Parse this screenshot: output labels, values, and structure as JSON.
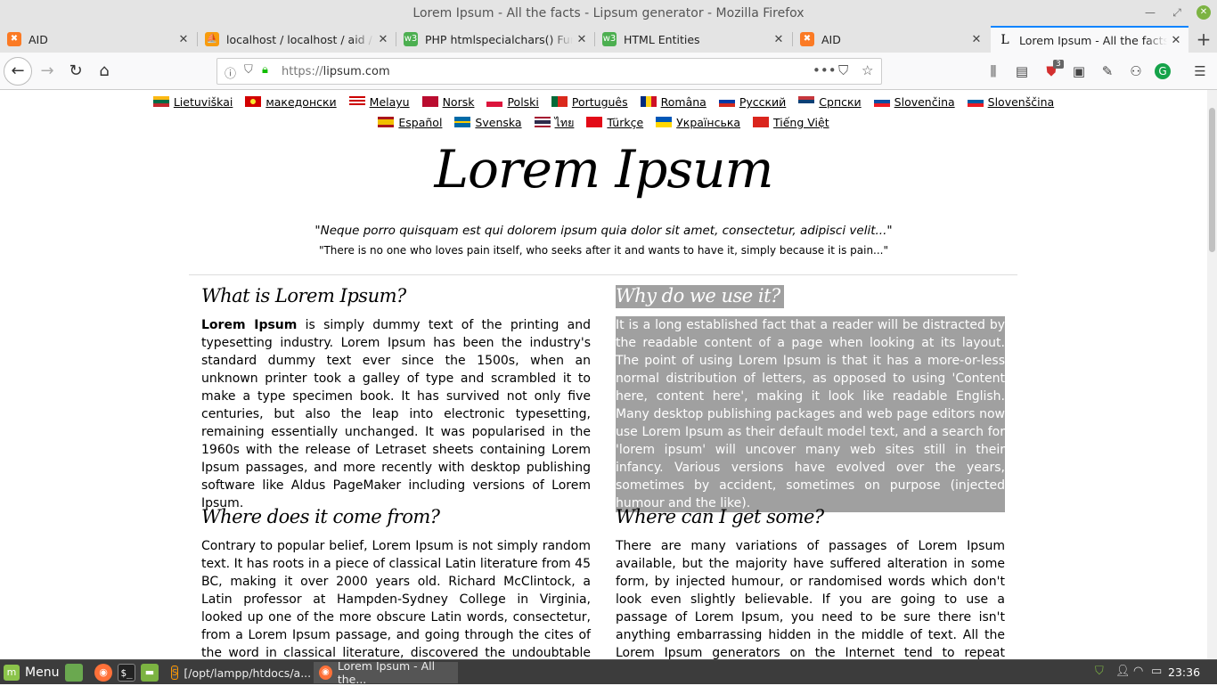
{
  "window": {
    "title": "Lorem Ipsum - All the facts - Lipsum generator - Mozilla Firefox"
  },
  "tabs": [
    {
      "label": "AID",
      "icon": "xampp-icon"
    },
    {
      "label": "localhost / localhost / aid / ph",
      "icon": "phpmyadmin-icon"
    },
    {
      "label": "PHP htmlspecialchars() Funct",
      "icon": "w3schools-icon"
    },
    {
      "label": "HTML Entities",
      "icon": "w3schools-icon"
    },
    {
      "label": "AID",
      "icon": "xampp-icon"
    },
    {
      "label": "Lorem Ipsum - All the facts - L",
      "icon": "lipsum-icon"
    }
  ],
  "navbar": {
    "url_proto": "https://",
    "url_host": "lipsum.com",
    "notification_count": "3"
  },
  "page": {
    "languages_row1": [
      "Lietuviškai",
      "македонски",
      "Melayu",
      "Norsk",
      "Polski",
      "Português",
      "Româna",
      "Pусский",
      "Српски",
      "Slovenčina",
      "Slovenščina"
    ],
    "languages_row2": [
      "Español",
      "Svenska",
      "ไทย",
      "Türkçe",
      "Українська",
      "Tiếng Việt"
    ],
    "title": "Lorem Ipsum",
    "quote_latin": "\"Neque porro quisquam est qui dolorem ipsum quia dolor sit amet, consectetur, adipisci velit...\"",
    "quote_english": "\"There is no one who loves pain itself, who seeks after it and wants to have it, simply because it is pain...\"",
    "what": {
      "heading": "What is Lorem Ipsum?",
      "bold": "Lorem Ipsum",
      "text": " is simply dummy text of the printing and typesetting industry. Lorem Ipsum has been the industry's standard dummy text ever since the 1500s, when an unknown printer took a galley of type and scrambled it to make a type specimen book. It has survived not only five centuries, but also the leap into electronic typesetting, remaining essentially unchanged. It was popularised in the 1960s with the release of Letraset sheets containing Lorem Ipsum passages, and more recently with desktop publishing software like Aldus PageMaker including versions of Lorem Ipsum."
    },
    "why": {
      "heading": "Why do we use it?",
      "text": "It is a long established fact that a reader will be distracted by the readable content of a page when looking at its layout. The point of using Lorem Ipsum is that it has a more-or-less normal distribution of letters, as opposed to using 'Content here, content here', making it look like readable English. Many desktop publishing packages and web page editors now use Lorem Ipsum as their default model text, and a search for 'lorem ipsum' will uncover many web sites still in their infancy. Various versions have evolved over the years, sometimes by accident, sometimes on purpose (injected humour and the like)."
    },
    "where_from": {
      "heading": "Where does it come from?",
      "text": "Contrary to popular belief, Lorem Ipsum is not simply random text. It has roots in a piece of classical Latin literature from 45 BC, making it over 2000 years old. Richard McClintock, a Latin professor at Hampden-Sydney College in Virginia, looked up one of the more obscure Latin words, consectetur, from a Lorem Ipsum passage, and going through the cites of the word in classical literature, discovered the undoubtable source. Lorem"
    },
    "where_get": {
      "heading": "Where can I get some?",
      "text": "There are many variations of passages of Lorem Ipsum available, but the majority have suffered alteration in some form, by injected humour, or randomised words which don't look even slightly believable. If you are going to use a passage of Lorem Ipsum, you need to be sure there isn't anything embarrassing hidden in the middle of text. All the Lorem Ipsum generators on the Internet tend to repeat predefined chunks as necessary,"
    }
  },
  "taskbar": {
    "menu_label": "Menu",
    "windows": [
      {
        "label": "[/opt/lampp/htdocs/a...",
        "icon": "sublime-icon"
      },
      {
        "label": "Lorem Ipsum - All the...",
        "icon": "firefox-icon"
      }
    ],
    "clock": "23:36"
  }
}
